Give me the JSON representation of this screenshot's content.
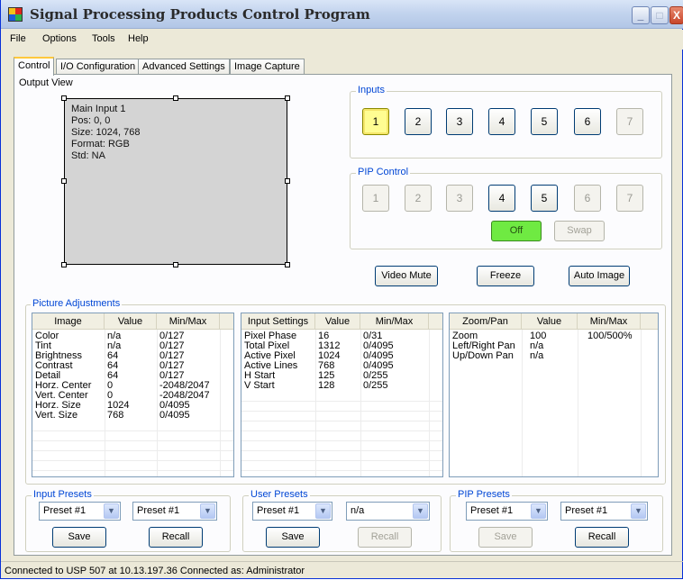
{
  "window": {
    "title": "Signal Processing Products Control Program",
    "minimize_glyph": "_",
    "maximize_glyph": "□",
    "close_glyph": "X"
  },
  "menu": [
    "File",
    "Options",
    "Tools",
    "Help"
  ],
  "tabs": [
    "Control",
    "I/O Configuration",
    "Advanced Settings",
    "Image Capture"
  ],
  "output_view": {
    "label": "Output View",
    "lines": [
      "Main Input 1",
      "Pos: 0, 0",
      "Size: 1024, 768",
      "Format: RGB",
      "Std: NA"
    ]
  },
  "inputs": {
    "label": "Inputs",
    "buttons": [
      "1",
      "2",
      "3",
      "4",
      "5",
      "6",
      "7"
    ],
    "selected": "1"
  },
  "pip_control": {
    "label": "PIP Control",
    "buttons": [
      "1",
      "2",
      "3",
      "4",
      "5",
      "6",
      "7"
    ],
    "off_label": "Off",
    "swap_label": "Swap"
  },
  "actions": {
    "video_mute": "Video Mute",
    "freeze": "Freeze",
    "auto_image": "Auto Image"
  },
  "picture_adjustments": {
    "label": "Picture Adjustments",
    "image_table": {
      "columns": [
        "Image",
        "Value",
        "Min/Max"
      ],
      "rows": [
        [
          "Color",
          "n/a",
          "0/127"
        ],
        [
          "Tint",
          "n/a",
          "0/127"
        ],
        [
          "Brightness",
          "64",
          "0/127"
        ],
        [
          "Contrast",
          "64",
          "0/127"
        ],
        [
          "Detail",
          "64",
          "0/127"
        ],
        [
          "Horz. Center",
          "0",
          "-2048/2047"
        ],
        [
          "Vert. Center",
          "0",
          "-2048/2047"
        ],
        [
          "Horz. Size",
          "1024",
          "0/4095"
        ],
        [
          "Vert. Size",
          "768",
          "0/4095"
        ]
      ]
    },
    "input_table": {
      "columns": [
        "Input Settings",
        "Value",
        "Min/Max"
      ],
      "rows": [
        [
          "Pixel Phase",
          "16",
          "0/31"
        ],
        [
          "Total Pixel",
          "1312",
          "0/4095"
        ],
        [
          "Active Pixel",
          "1024",
          "0/4095"
        ],
        [
          "Active Lines",
          "768",
          "0/4095"
        ],
        [
          "H Start",
          "125",
          "0/255"
        ],
        [
          "V Start",
          "128",
          "0/255"
        ]
      ]
    },
    "zoom_table": {
      "columns": [
        "Zoom/Pan",
        "Value",
        "Min/Max"
      ],
      "rows": [
        [
          "Zoom",
          "100",
          "100/500%"
        ],
        [
          "Left/Right Pan",
          "n/a",
          ""
        ],
        [
          "Up/Down Pan",
          "n/a",
          ""
        ]
      ]
    }
  },
  "input_presets": {
    "label": "Input Presets",
    "combo1": "Preset #1",
    "combo2": "Preset #1",
    "save": "Save",
    "recall": "Recall"
  },
  "user_presets": {
    "label": "User Presets",
    "combo1": "Preset #1",
    "combo2": "n/a",
    "save": "Save",
    "recall": "Recall"
  },
  "pip_presets": {
    "label": "PIP Presets",
    "combo1": "Preset #1",
    "combo2": "Preset #1",
    "save": "Save",
    "recall": "Recall"
  },
  "combo_arrow_glyph": "▼",
  "status": "Connected to USP 507 at 10.13.197.36   Connected as: Administrator"
}
